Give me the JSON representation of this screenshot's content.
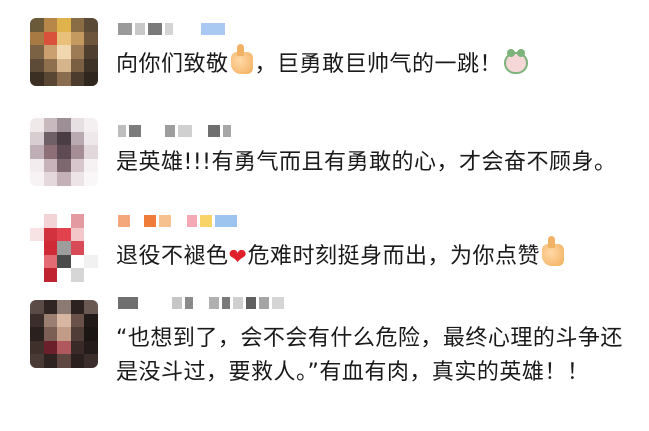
{
  "comments": [
    {
      "text_before": "向你们致敬",
      "emoji1": "thumbs-up",
      "text_after": "，巨勇敢巨帅气的一跳！",
      "emoji2": "frog-face"
    },
    {
      "text": "是英雄!!!有勇气而且有勇敢的心，才会奋不顾身。"
    },
    {
      "text_before": "退役不褪色",
      "emoji1": "red-heart",
      "text_middle": "危难时刻挺身而出，为你点赞",
      "emoji2": "thumbs-up"
    },
    {
      "text": "“也想到了，会不会有什么危险，最终心理的斗争还是没斗过，要救人。”有血有肉，真实的英雄！！"
    }
  ],
  "colors": {
    "background": "#ffffff",
    "text": "#1a1a1a",
    "heart": "#e0202a"
  }
}
